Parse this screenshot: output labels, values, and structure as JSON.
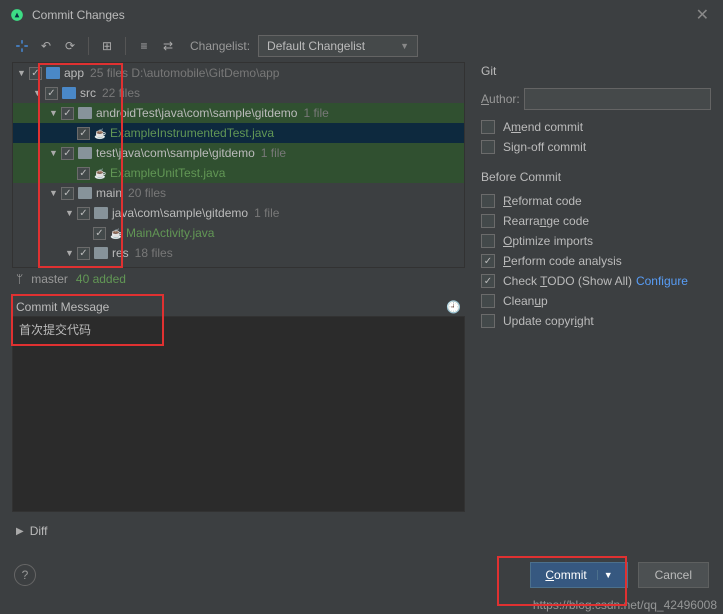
{
  "window": {
    "title": "Commit Changes"
  },
  "toolbar": {
    "changelist_label": "Changelist:",
    "changelist_value": "Default Changelist"
  },
  "tree": {
    "rows": [
      {
        "indent": 0,
        "expanded": true,
        "checked": true,
        "icon": "folder-blue",
        "name": "app",
        "nameClass": "",
        "meta": "25 files  D:\\automobile\\GitDemo\\app"
      },
      {
        "indent": 1,
        "expanded": true,
        "checked": true,
        "icon": "folder-blue",
        "name": "src",
        "nameClass": "",
        "meta": "22 files"
      },
      {
        "indent": 2,
        "expanded": true,
        "checked": true,
        "icon": "folder",
        "name": "androidTest\\java\\com\\sample\\gitdemo",
        "nameClass": "",
        "meta": "1 file",
        "rowClass": "green-sel"
      },
      {
        "indent": 3,
        "expanded": null,
        "checked": true,
        "icon": "java",
        "name": "ExampleInstrumentedTest.java",
        "nameClass": "added",
        "meta": "",
        "rowClass": "selected"
      },
      {
        "indent": 2,
        "expanded": true,
        "checked": true,
        "icon": "folder",
        "name": "test\\java\\com\\sample\\gitdemo",
        "nameClass": "",
        "meta": "1 file",
        "rowClass": "green-sel"
      },
      {
        "indent": 3,
        "expanded": null,
        "checked": true,
        "icon": "java",
        "name": "ExampleUnitTest.java",
        "nameClass": "added",
        "meta": "",
        "rowClass": "green-sel"
      },
      {
        "indent": 2,
        "expanded": true,
        "checked": true,
        "icon": "folder",
        "name": "main",
        "nameClass": "",
        "meta": "20 files"
      },
      {
        "indent": 3,
        "expanded": true,
        "checked": true,
        "icon": "folder",
        "name": "java\\com\\sample\\gitdemo",
        "nameClass": "",
        "meta": "1 file"
      },
      {
        "indent": 4,
        "expanded": null,
        "checked": true,
        "icon": "java",
        "name": "MainActivity.java",
        "nameClass": "added",
        "meta": ""
      },
      {
        "indent": 3,
        "expanded": true,
        "checked": true,
        "icon": "folder",
        "name": "res",
        "nameClass": "",
        "meta": "18 files"
      }
    ]
  },
  "branch": {
    "name": "master",
    "status": "40 added"
  },
  "commit_message": {
    "header": "Commit Message",
    "text": "首次提交代码"
  },
  "diff": {
    "label": "Diff"
  },
  "git": {
    "title": "Git",
    "author_label": "Author:",
    "author_value": "",
    "amend": "Amend commit",
    "signoff": "Sign-off commit"
  },
  "before_commit": {
    "title": "Before Commit",
    "items": [
      {
        "label": "Reformat code",
        "checked": false
      },
      {
        "label": "Rearrange code",
        "checked": false
      },
      {
        "label": "Optimize imports",
        "checked": false
      },
      {
        "label": "Perform code analysis",
        "checked": true
      },
      {
        "label": "Check TODO (Show All)",
        "checked": true,
        "link": "Configure"
      },
      {
        "label": "Cleanup",
        "checked": false
      },
      {
        "label": "Update copyright",
        "checked": false
      }
    ]
  },
  "footer": {
    "commit": "Commit",
    "cancel": "Cancel"
  },
  "watermark": "https://blog.csdn.net/qq_42496008"
}
